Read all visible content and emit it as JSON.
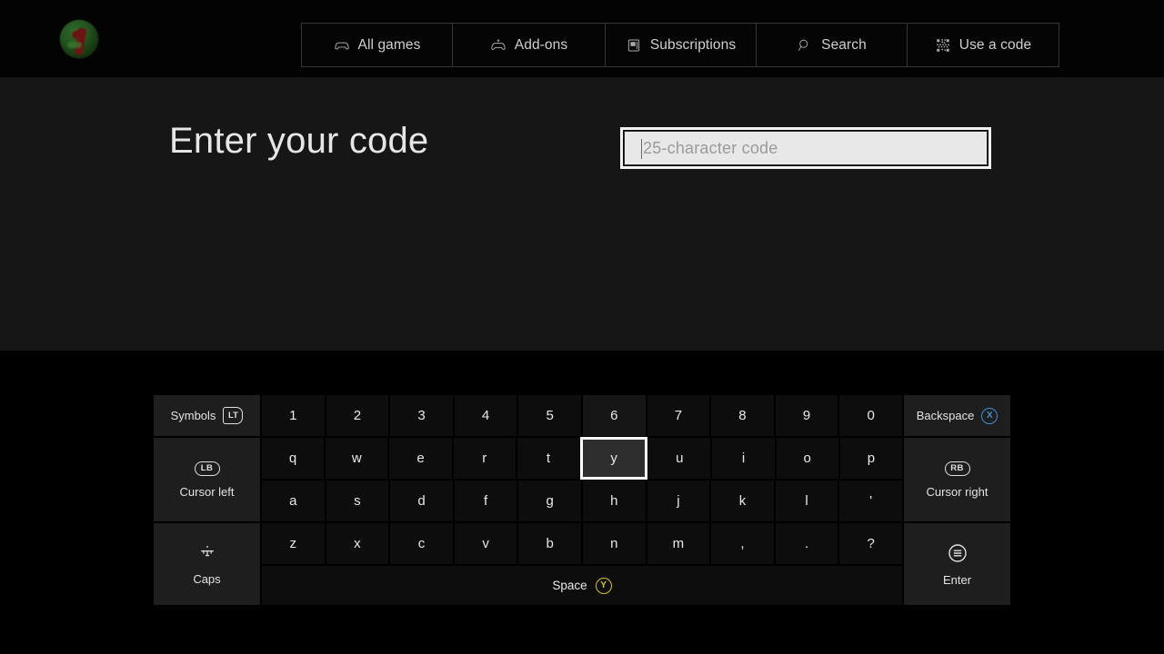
{
  "header": {
    "avatar": {
      "name": "user-avatar"
    },
    "nav": [
      {
        "id": "all-games",
        "label": "All games",
        "icon": "controller-icon"
      },
      {
        "id": "add-ons",
        "label": "Add-ons",
        "icon": "controller-plus-icon"
      },
      {
        "id": "subscriptions",
        "label": "Subscriptions",
        "icon": "card-icon"
      },
      {
        "id": "search",
        "label": "Search",
        "icon": "search-icon"
      },
      {
        "id": "use-a-code",
        "label": "Use a code",
        "icon": "qr-code-icon"
      }
    ]
  },
  "main": {
    "title": "Enter your code",
    "code_input": {
      "value": "",
      "placeholder": "25-character code"
    }
  },
  "keyboard": {
    "left": [
      {
        "id": "symbols",
        "label": "Symbols",
        "badge": "LT",
        "badge_type": "trigger",
        "layout": "inline"
      },
      {
        "id": "cursor-left",
        "label": "Cursor left",
        "badge": "LB",
        "badge_type": "bumper",
        "layout": "stacked"
      },
      {
        "id": "caps",
        "label": "Caps",
        "badge": "",
        "badge_type": "caps-icon",
        "layout": "stacked"
      }
    ],
    "right": [
      {
        "id": "backspace",
        "label": "Backspace",
        "badge": "X",
        "badge_type": "button-x",
        "layout": "inline"
      },
      {
        "id": "cursor-right",
        "label": "Cursor right",
        "badge": "RB",
        "badge_type": "bumper",
        "layout": "stacked"
      },
      {
        "id": "enter",
        "label": "Enter",
        "badge": "",
        "badge_type": "menu-icon",
        "layout": "stacked"
      }
    ],
    "rows": [
      [
        "1",
        "2",
        "3",
        "4",
        "5",
        "6",
        "7",
        "8",
        "9",
        "0"
      ],
      [
        "q",
        "w",
        "e",
        "r",
        "t",
        "y",
        "u",
        "i",
        "o",
        "p"
      ],
      [
        "a",
        "s",
        "d",
        "f",
        "g",
        "h",
        "j",
        "k",
        "l",
        "'"
      ],
      [
        "z",
        "x",
        "c",
        "v",
        "b",
        "n",
        "m",
        ",",
        ".",
        "?"
      ]
    ],
    "space": {
      "label": "Space",
      "badge": "Y"
    },
    "selected_key": "y",
    "hover_key": "6",
    "colors": {
      "selection_border": "#ffffff",
      "button_x": "#3e8fd0",
      "button_y": "#d8c227",
      "key_bg": "#0d0d0d",
      "side_key_bg": "#1e1e1e"
    }
  }
}
